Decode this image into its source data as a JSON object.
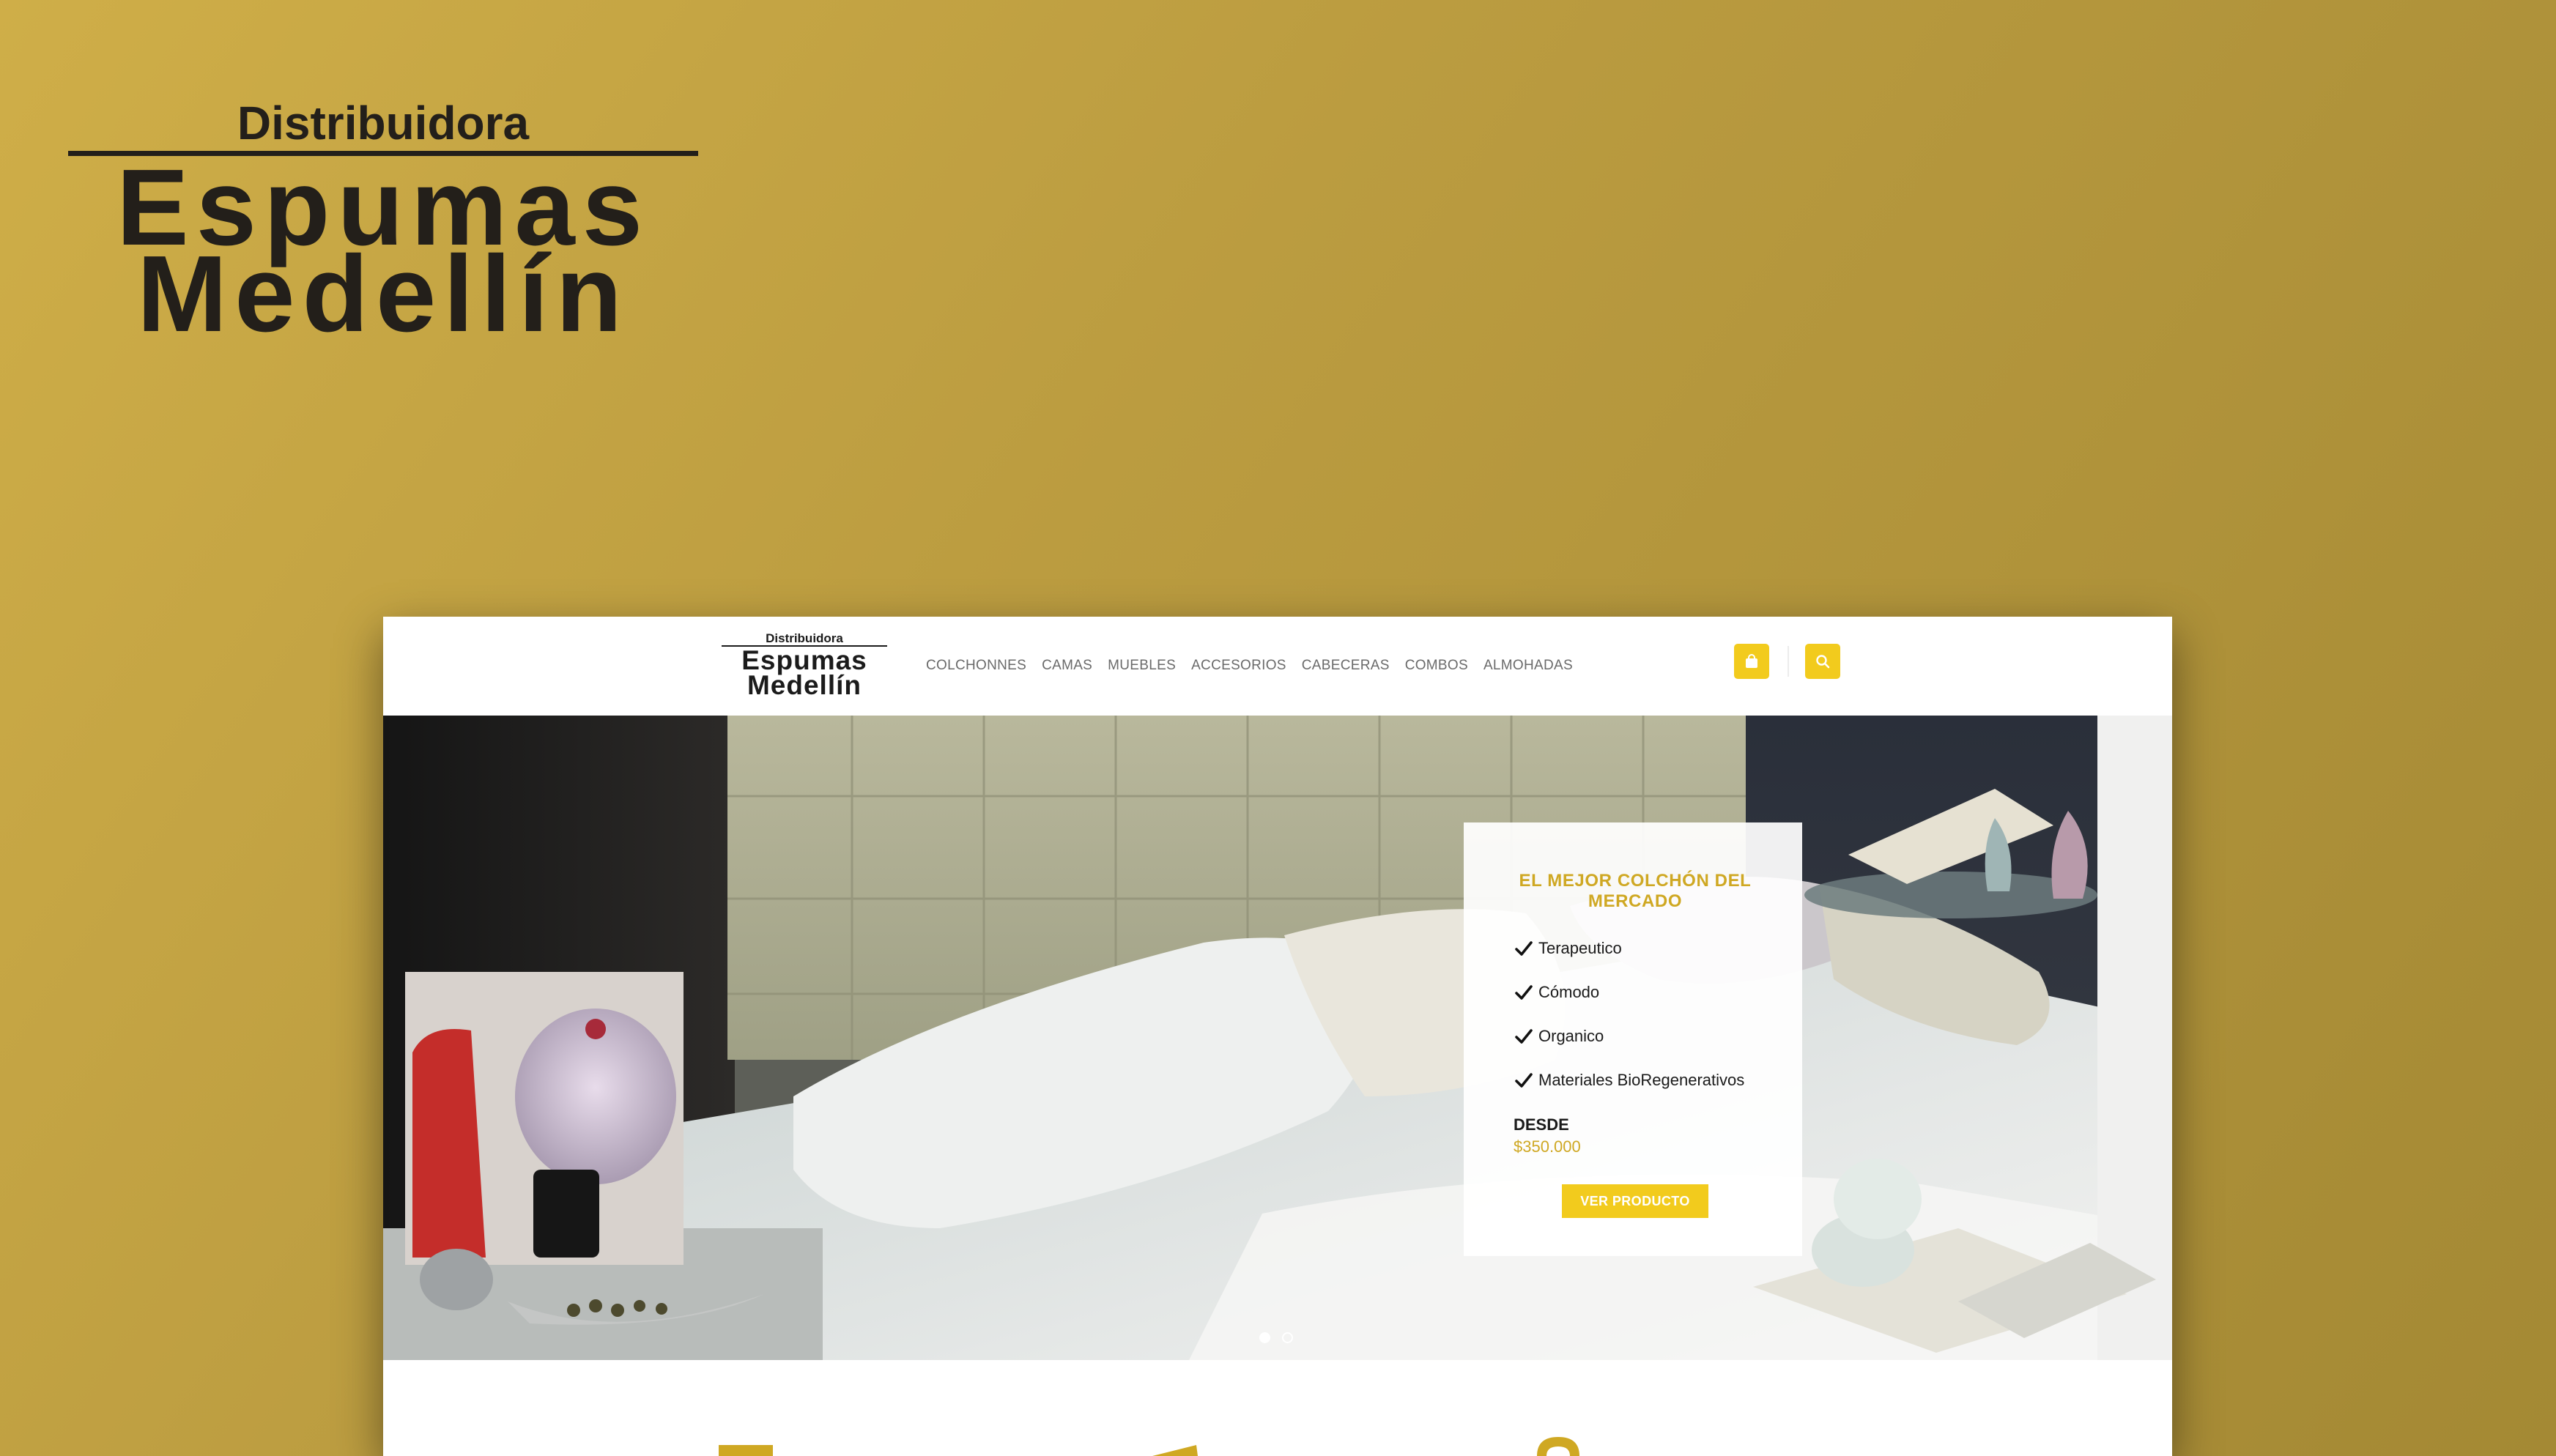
{
  "brand": {
    "distribuidora": "Distribuidora",
    "line1": "Espumas",
    "line2": "Medellín"
  },
  "nav": {
    "items": [
      "COLCHONNES",
      "CAMAS",
      "MUEBLES",
      "ACCESORIOS",
      "CABECERAS",
      "COMBOS",
      "ALMOHADAS"
    ],
    "cart_icon": "shopping-bag-icon",
    "search_icon": "search-icon"
  },
  "promo": {
    "title": "EL MEJOR COLCHÓN DEL MERCADO",
    "features": [
      "Terapeutico",
      "Cómodo",
      "Organico",
      "Materiales BioRegenerativos"
    ],
    "desde": "DESDE",
    "price": "$350.000",
    "cta": "VER PRODUCTO"
  },
  "slider": {
    "slide_count": 2,
    "active_slide": 1
  },
  "colors": {
    "accent": "#f2cb1d",
    "gold_text": "#cfa823",
    "background": "#bfa042",
    "logo_dark": "#231f1a"
  }
}
